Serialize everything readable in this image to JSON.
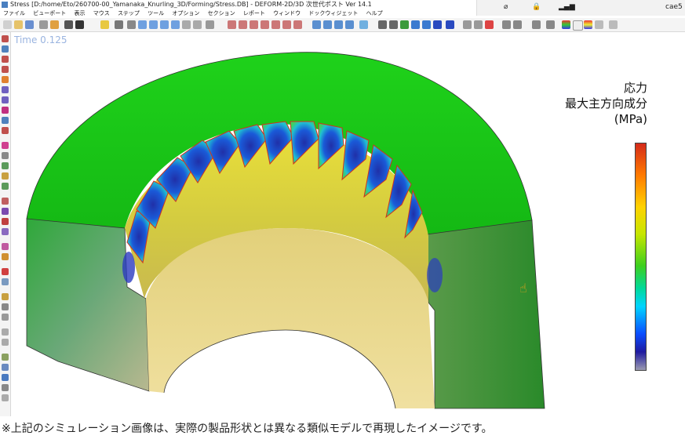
{
  "window": {
    "title": "Stress [D:/home/Eto/260700-00_Yamanaka_Knurling_3D/Forming/Stress.DB] - DEFORM-2D/3D 次世代ポスト Ver 14.1"
  },
  "system_tray": {
    "user": "cae5"
  },
  "menu": [
    "ファイル",
    "ビューポート",
    "表示",
    "マウス",
    "ステップ",
    "ツール",
    "オプション",
    "セクション",
    "レポート",
    "ウィンドウ",
    "ドックウィジェット",
    "ヘルプ"
  ],
  "viewport": {
    "time_label": "Time 0.125"
  },
  "legend": {
    "line1": "応力",
    "line2": "最大主方向成分",
    "line3": "(MPa)"
  },
  "caption": "※上記のシミュレーション画像は、実際の製品形状とは異なる類似モデルで再現したイメージです。",
  "colors": {
    "high": "#d42a1a",
    "mid": "#3dcf1e",
    "low": "#1f1aa0",
    "ring_green": "#23c81a",
    "inner_yellow": "#d9d23a"
  }
}
